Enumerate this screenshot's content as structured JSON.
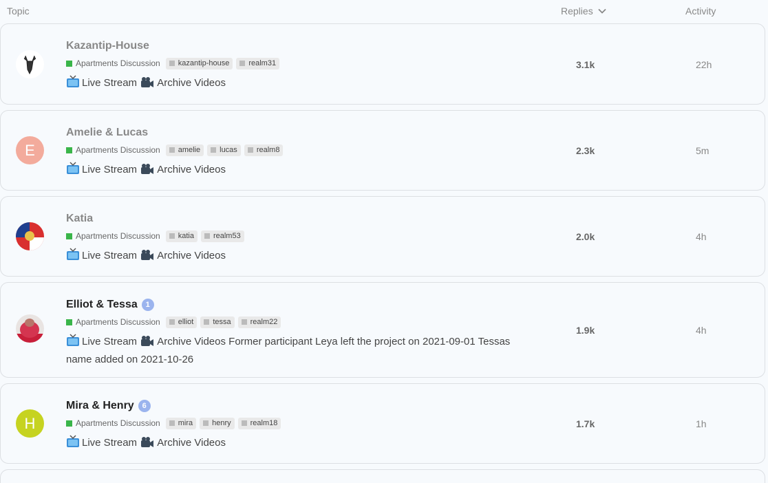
{
  "header": {
    "topic": "Topic",
    "replies": "Replies",
    "activity": "Activity"
  },
  "colors": {
    "category": "#3ab54a",
    "badge": "#9bb4ee"
  },
  "topics": [
    {
      "title": "Kazantip-House",
      "unread": false,
      "avatar": {
        "type": "image",
        "icon": "antler-deer-icon"
      },
      "category": "Apartments Discussion",
      "tags": [
        "kazantip-house",
        "realm31"
      ],
      "live": "Live Stream",
      "archive": "Archive Videos",
      "extra": "",
      "replies": "3.1k",
      "activity": "22h"
    },
    {
      "title": "Amelie & Lucas",
      "unread": false,
      "avatar": {
        "type": "letter",
        "letter": "E",
        "color": "#f3ab9c"
      },
      "category": "Apartments Discussion",
      "tags": [
        "amelie",
        "lucas",
        "realm8"
      ],
      "live": "Live Stream",
      "archive": "Archive Videos",
      "extra": "",
      "replies": "2.3k",
      "activity": "5m"
    },
    {
      "title": "Katia",
      "unread": false,
      "avatar": {
        "type": "image",
        "icon": "flag-photo-icon"
      },
      "category": "Apartments Discussion",
      "tags": [
        "katia",
        "realm53"
      ],
      "live": "Live Stream",
      "archive": "Archive Videos",
      "extra": "",
      "replies": "2.0k",
      "activity": "4h"
    },
    {
      "title": "Elliot & Tessa",
      "unread": true,
      "badge": "1",
      "avatar": {
        "type": "image",
        "icon": "person-photo-icon"
      },
      "category": "Apartments Discussion",
      "tags": [
        "elliot",
        "tessa",
        "realm22"
      ],
      "live": "Live Stream",
      "archive": "Archive Videos",
      "extra": "Former participant Leya left the project on 2021-09-01 Tessas name added on 2021-10-26",
      "replies": "1.9k",
      "activity": "4h"
    },
    {
      "title": "Mira & Henry",
      "unread": true,
      "badge": "6",
      "avatar": {
        "type": "letter",
        "letter": "H",
        "color": "#c6d321"
      },
      "category": "Apartments Discussion",
      "tags": [
        "mira",
        "henry",
        "realm18"
      ],
      "live": "Live Stream",
      "archive": "Archive Videos",
      "extra": "",
      "replies": "1.7k",
      "activity": "1h"
    }
  ]
}
